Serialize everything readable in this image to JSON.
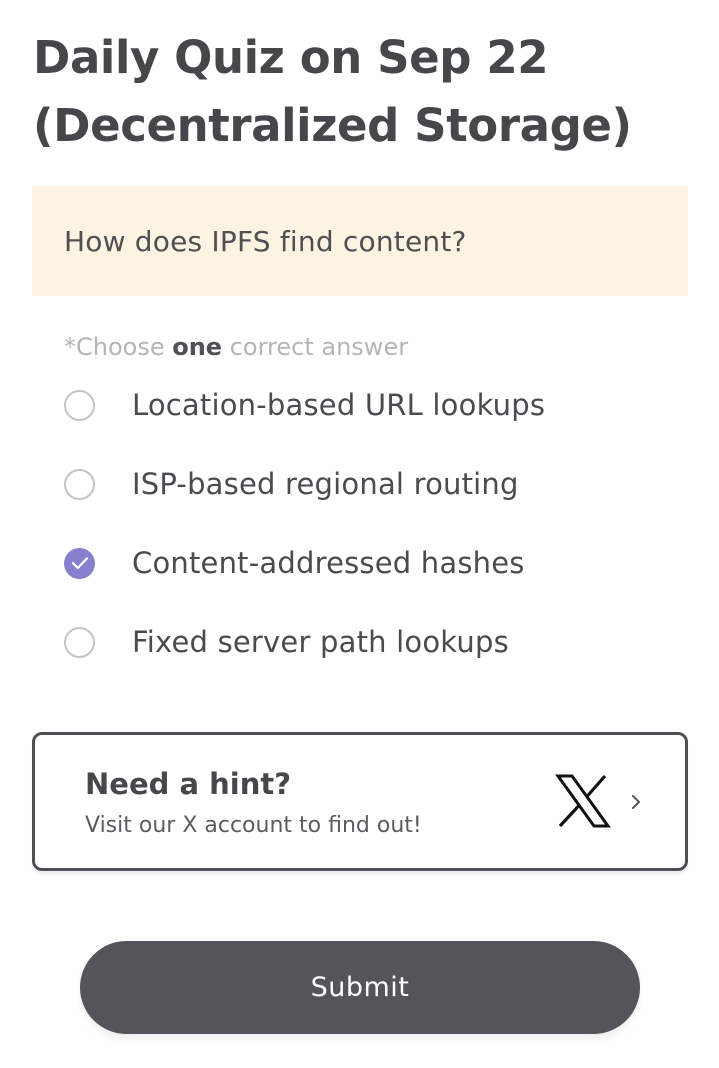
{
  "page": {
    "title_line1": "Daily Quiz on Sep 22",
    "title_line2": "(Decentralized Storage)"
  },
  "question": {
    "text": "How does IPFS find content?"
  },
  "instruction": {
    "prefix": "*Choose ",
    "emphasis": "one",
    "suffix": " correct answer"
  },
  "options": [
    {
      "label": "Location-based URL lookups",
      "selected": false
    },
    {
      "label": "ISP-based regional routing",
      "selected": false
    },
    {
      "label": "Content-addressed hashes",
      "selected": true
    },
    {
      "label": "Fixed server path lookups",
      "selected": false
    }
  ],
  "hint": {
    "title": "Need a hint?",
    "subtitle": "Visit our X account to find out!",
    "logo_icon": "x-logo-icon",
    "arrow_icon": "chevron-right-icon"
  },
  "submit": {
    "label": "Submit"
  },
  "colors": {
    "question_bg": "#fdf3e2",
    "selected_radio": "#8680cf",
    "submit_bg": "#53555b",
    "instruction_muted": "#b4b5b7"
  }
}
